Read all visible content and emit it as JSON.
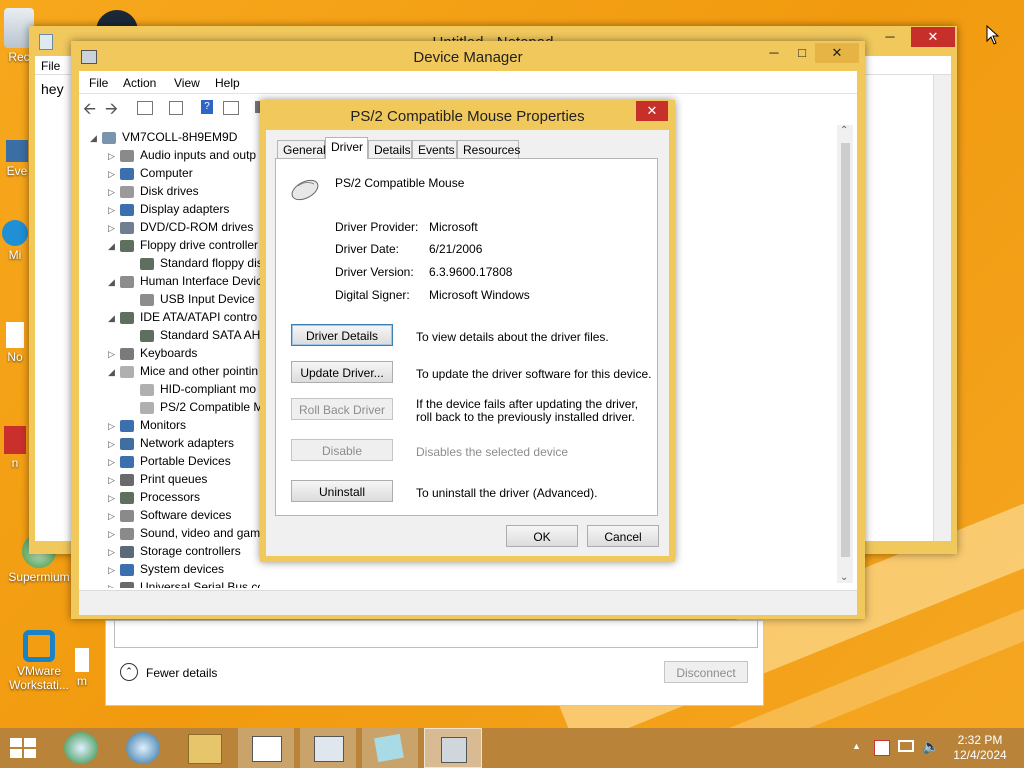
{
  "desktop": {
    "icons": [
      {
        "label": "Rec"
      },
      {
        "label": "Eve"
      },
      {
        "label": "Mi"
      },
      {
        "label": "No"
      },
      {
        "label": "n"
      },
      {
        "label": "Supermium"
      },
      {
        "label": "VMware Workstati..."
      },
      {
        "label": "m"
      }
    ]
  },
  "notepad": {
    "title": "Untitled - Notepad",
    "menu_file": "File",
    "content": "hey"
  },
  "device_manager": {
    "title": "Device Manager",
    "menu": [
      "File",
      "Action",
      "View",
      "Help"
    ],
    "tree": [
      {
        "label": "VM7COLL-8H9EM9D",
        "level": 0,
        "arrow": "◢",
        "icon": "computer"
      },
      {
        "label": "Audio inputs and outp",
        "level": 1,
        "arrow": "▷",
        "icon": "speaker"
      },
      {
        "label": "Computer",
        "level": 1,
        "arrow": "▷",
        "icon": "monitor"
      },
      {
        "label": "Disk drives",
        "level": 1,
        "arrow": "▷",
        "icon": "disk"
      },
      {
        "label": "Display adapters",
        "level": 1,
        "arrow": "▷",
        "icon": "monitor"
      },
      {
        "label": "DVD/CD-ROM drives",
        "level": 1,
        "arrow": "▷",
        "icon": "dvd"
      },
      {
        "label": "Floppy drive controller",
        "level": 1,
        "arrow": "◢",
        "icon": "chip"
      },
      {
        "label": "Standard floppy dis",
        "level": 2,
        "arrow": "",
        "icon": "chip"
      },
      {
        "label": "Human Interface Devic",
        "level": 1,
        "arrow": "◢",
        "icon": "hid"
      },
      {
        "label": "USB Input Device",
        "level": 2,
        "arrow": "",
        "icon": "hid"
      },
      {
        "label": "IDE ATA/ATAPI contro",
        "level": 1,
        "arrow": "◢",
        "icon": "chip"
      },
      {
        "label": "Standard SATA AH",
        "level": 2,
        "arrow": "",
        "icon": "chip"
      },
      {
        "label": "Keyboards",
        "level": 1,
        "arrow": "▷",
        "icon": "keyboard"
      },
      {
        "label": "Mice and other pointin",
        "level": 1,
        "arrow": "◢",
        "icon": "mouse"
      },
      {
        "label": "HID-compliant mo",
        "level": 2,
        "arrow": "",
        "icon": "mouse"
      },
      {
        "label": "PS/2 Compatible M",
        "level": 2,
        "arrow": "",
        "icon": "mouse"
      },
      {
        "label": "Monitors",
        "level": 1,
        "arrow": "▷",
        "icon": "monitor"
      },
      {
        "label": "Network adapters",
        "level": 1,
        "arrow": "▷",
        "icon": "network"
      },
      {
        "label": "Portable Devices",
        "level": 1,
        "arrow": "▷",
        "icon": "monitor"
      },
      {
        "label": "Print queues",
        "level": 1,
        "arrow": "▷",
        "icon": "printer"
      },
      {
        "label": "Processors",
        "level": 1,
        "arrow": "▷",
        "icon": "chip"
      },
      {
        "label": "Software devices",
        "level": 1,
        "arrow": "▷",
        "icon": "speaker"
      },
      {
        "label": "Sound, video and gam",
        "level": 1,
        "arrow": "▷",
        "icon": "speaker"
      },
      {
        "label": "Storage controllers",
        "level": 1,
        "arrow": "▷",
        "icon": "storage"
      },
      {
        "label": "System devices",
        "level": 1,
        "arrow": "▷",
        "icon": "monitor"
      },
      {
        "label": "Universal Serial Bus controllers",
        "level": 1,
        "arrow": "▷",
        "icon": "usb"
      }
    ]
  },
  "properties": {
    "title": "PS/2 Compatible Mouse Properties",
    "tabs": [
      "General",
      "Driver",
      "Details",
      "Events",
      "Resources"
    ],
    "active_tab": "Driver",
    "device_name": "PS/2 Compatible Mouse",
    "driver_provider_label": "Driver Provider:",
    "driver_provider": "Microsoft",
    "driver_date_label": "Driver Date:",
    "driver_date": "6/21/2006",
    "driver_version_label": "Driver Version:",
    "driver_version": "6.3.9600.17808",
    "digital_signer_label": "Digital Signer:",
    "digital_signer": "Microsoft Windows",
    "buttons": {
      "driver_details": "Driver Details",
      "update_driver": "Update Driver...",
      "roll_back": "Roll Back Driver",
      "disable": "Disable",
      "uninstall": "Uninstall",
      "ok": "OK",
      "cancel": "Cancel"
    },
    "descriptions": {
      "driver_details": "To view details about the driver files.",
      "update_driver": "To update the driver software for this device.",
      "roll_back": "If the device fails after updating the driver, roll back to the previously installed driver.",
      "disable": "Disables the selected device",
      "uninstall": "To uninstall the driver (Advanced)."
    }
  },
  "connect_panel": {
    "fewer_details": "Fewer details",
    "disconnect": "Disconnect"
  },
  "taskbar": {
    "time": "2:32 PM",
    "date": "12/4/2024"
  },
  "colors": {
    "desktop": "#f19a0f",
    "window_frame": "#f0c85c",
    "close_button": "#c7302a",
    "taskbar": "#b9843a"
  }
}
